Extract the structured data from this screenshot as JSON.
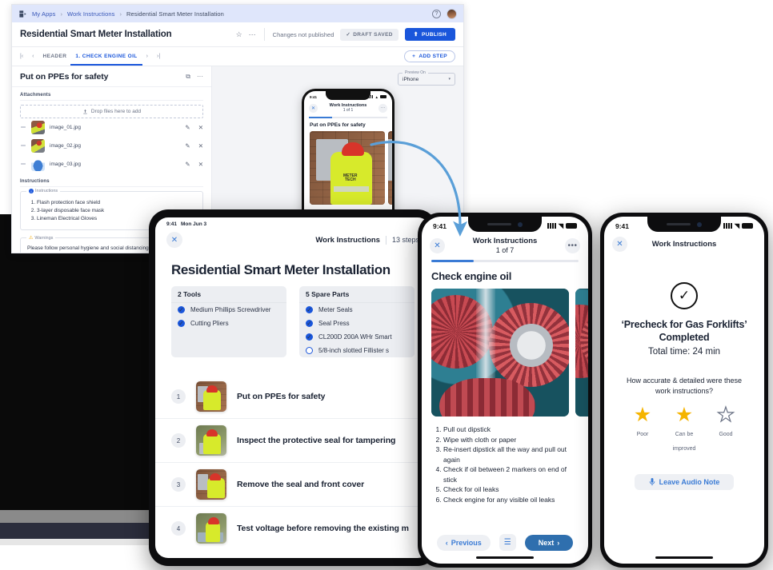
{
  "webapp": {
    "breadcrumb": {
      "app_icon": "app-grid-icon",
      "items": [
        "My Apps",
        "Work Instructions",
        "Residential Smart Meter Installation"
      ],
      "separator": "›",
      "help_icon": "?",
      "avatar": "user-avatar"
    },
    "title": "Residential Smart Meter Installation",
    "star_icon": "☆",
    "more_icon": "···",
    "status_text": "Changes not published",
    "draft_label": "DRAFT SAVED",
    "draft_check": "✓",
    "publish_label": "PUBLISH",
    "publish_icon": "⬆",
    "tabs": {
      "first": "|‹",
      "prev": "‹",
      "items": [
        "HEADER",
        "1. CHECK ENGINE OIL"
      ],
      "next": "›",
      "last": "›|",
      "active_index": 1
    },
    "add_step_label": "ADD STEP",
    "add_step_icon": "+",
    "step_title": "Put on PPEs for safety",
    "copy_icon": "⧉",
    "step_more_icon": "···",
    "attachments_label": "Attachments",
    "dropzone_text": "Drop files here to add",
    "dropzone_icon": "upload-icon",
    "files": [
      {
        "name": "image_01.jpg",
        "thumb": "worker-meter-photo",
        "edit_icon": "✎",
        "delete_icon": "✕"
      },
      {
        "name": "image_02.jpg",
        "thumb": "worker-meter-photo",
        "edit_icon": "✎",
        "delete_icon": "✕"
      },
      {
        "name": "image_03.jpg",
        "thumb": "face-mask-photo",
        "edit_icon": "✎",
        "delete_icon": "✕"
      }
    ],
    "instructions_label": "Instructions",
    "instructions_legend": "Instructions",
    "instructions_items": [
      "Flash protection face shield",
      "3-layer disposable face mask",
      "Lineman Electrical Gloves"
    ],
    "warnings_legend": "Warnings",
    "warnings_text": "Please follow personal hygiene and social distancing",
    "preview_legend": "Preview On",
    "preview_value": "iPhone",
    "preview_caret": "▾"
  },
  "preview_phone": {
    "time": "9:41",
    "close_icon": "✕",
    "nav_title": "Work Instructions",
    "nav_sub": "1 of 1",
    "more_icon": "···",
    "step_title": "Put on PPEs for safety",
    "image_label_line1": "METER",
    "image_label_line2": "TECH"
  },
  "ipad": {
    "time": "9:41",
    "date": "Mon Jun 3",
    "close_icon": "✕",
    "nav_title": "Work Instructions",
    "steps_count": "13 steps",
    "heading": "Residential Smart Meter Installation",
    "tools_card": {
      "header": "2 Tools",
      "items": [
        {
          "label": "Medium Phillips Screwdriver",
          "checked": true
        },
        {
          "label": "Cutting Pliers",
          "checked": true
        }
      ]
    },
    "parts_card": {
      "header": "5 Spare Parts",
      "items": [
        {
          "label": "Meter Seals",
          "checked": true
        },
        {
          "label": "Seal Press",
          "checked": true
        },
        {
          "label": "CL200D 200A WHr Smart",
          "checked": true
        },
        {
          "label": "5/8-inch slotted Fillister s",
          "checked": false
        }
      ]
    },
    "steps": [
      {
        "num": "1",
        "text": "Put on PPEs for safety"
      },
      {
        "num": "2",
        "text": "Inspect the protective seal for tampering"
      },
      {
        "num": "3",
        "text": "Remove the seal and front cover"
      },
      {
        "num": "4",
        "text": "Test voltage before removing the existing m"
      }
    ],
    "check_glyph": "✓"
  },
  "phone_center": {
    "time": "9:41",
    "close_icon": "✕",
    "nav_title": "Work Instructions",
    "nav_sub": "1 of 7",
    "more_icon": "•••",
    "step_title": "Check engine oil",
    "image_alt": "gears-photo",
    "instructions": [
      "Pull out dipstick",
      "Wipe with cloth or paper",
      "Re-insert dipstick all the way and pull out again",
      "Check if oil between 2 markers on end of stick",
      "Check for oil leaks",
      "Check engine for any visible oil leaks"
    ],
    "previous_label": "Previous",
    "previous_icon": "‹",
    "list_icon": "☰",
    "next_label": "Next",
    "next_icon": "›"
  },
  "phone_right": {
    "time": "9:41",
    "close_icon": "✕",
    "nav_title": "Work Instructions",
    "check_icon": "✓",
    "completed_title": "‘Precheck for Gas Forklifts’ Completed",
    "total_time": "Total time: 24 min",
    "question": "How accurate & detailed were these work instructions?",
    "ratings": [
      {
        "label": "Poor",
        "filled": true
      },
      {
        "label": "Can be improved",
        "filled": true
      },
      {
        "label": "Good",
        "filled": false
      }
    ],
    "star_glyph": "★",
    "star_empty_glyph": "★",
    "audio_label": "Leave Audio Note",
    "audio_icon": "🎤"
  },
  "colors": {
    "brand_blue": "#1a56db",
    "accent_blue": "#3a7bd5",
    "next_button": "#2f6fae",
    "star_gold": "#f5b400",
    "arrow_blue": "#5a9fd8",
    "breadcrumb_bg": "#dfe6fb"
  }
}
